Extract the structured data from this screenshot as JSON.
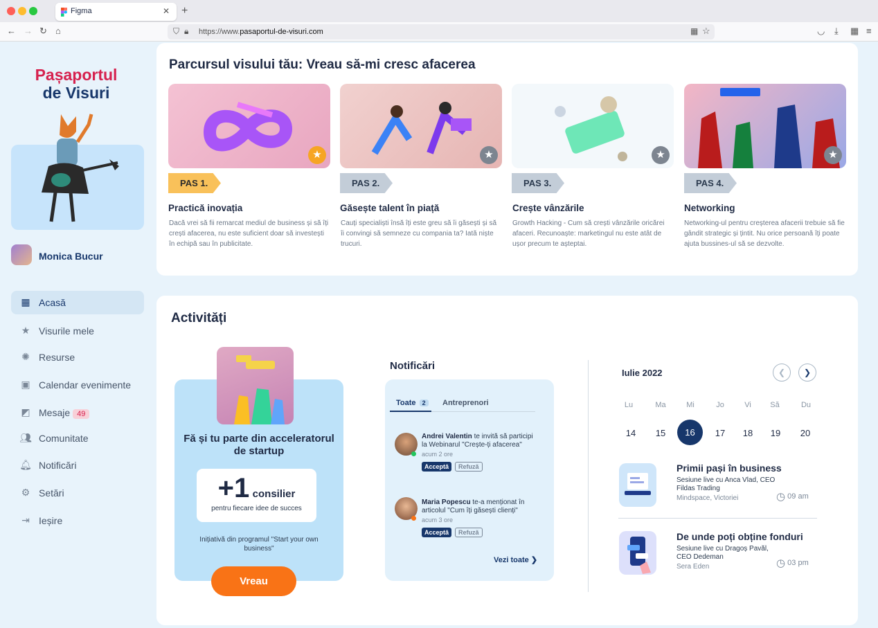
{
  "browser": {
    "tab_title": "Figma",
    "url_prefix": "https://www.",
    "url_domain": "pasaportul-de-visuri.com"
  },
  "sidebar": {
    "logo_line1": "Pașaportul",
    "logo_line2": "de Visuri",
    "user_name": "Monica Bucur",
    "items": [
      {
        "label": "Acasă",
        "icon": "grid-icon",
        "active": true
      },
      {
        "label": "Visurile mele",
        "icon": "star-icon"
      },
      {
        "label": "Resurse",
        "icon": "bulb-icon"
      },
      {
        "label": "Calendar evenimente",
        "icon": "calendar-icon"
      },
      {
        "label": "Mesaje",
        "icon": "chat-icon",
        "badge": "49"
      },
      {
        "label": "Comunitate",
        "icon": "people-icon"
      },
      {
        "label": "Notificări",
        "icon": "bell-icon"
      },
      {
        "label": "Setări",
        "icon": "gear-icon"
      },
      {
        "label": "Ieșire",
        "icon": "logout-icon"
      }
    ]
  },
  "journey": {
    "title": "Parcursul visului tău:  Vreau să-mi cresc afacerea",
    "steps": [
      {
        "pas": "PAS 1.",
        "title": "Practică inovația",
        "desc": "Dacă vrei să fii remarcat mediul de business și să îți crești afacerea, nu este suficient doar să investești în echipă sau în publicitate.",
        "star": "gold"
      },
      {
        "pas": "PAS 2.",
        "title": "Găsește talent în piață",
        "desc": "Cauți specialiști însă îți este greu să îi găsești și să îi convingi să semneze cu compania ta? Iată niște trucuri.",
        "star": "grey"
      },
      {
        "pas": "PAS 3.",
        "title": "Crește vânzările",
        "desc": "Growth Hacking - Cum să crești vânzările oricărei afaceri. Recunoaște: marketingul nu este atât de ușor precum te așteptai.",
        "star": "grey"
      },
      {
        "pas": "PAS 4.",
        "title": "Networking",
        "desc": "Networking-ul pentru creșterea afacerii trebuie să fie gândit strategic și țintit. Nu orice persoană îți poate ajuta bussines-ul să se dezvolte.",
        "star": "grey"
      }
    ]
  },
  "activities": {
    "title": "Activități",
    "accelerator": {
      "title": "Fă și tu parte din acceleratorul de startup",
      "big": "+1",
      "big_word": "consilier",
      "sub": "pentru fiecare idee de succes",
      "note": "Inițiativă din programul \"Start your own business\"",
      "button": "Vreau"
    },
    "notifications": {
      "title": "Notificări",
      "tab_all": "Toate",
      "tab_all_count": "2",
      "tab_other": "Antreprenori",
      "items": [
        {
          "name": "Andrei Valentin",
          "text": " te invită să participi la Webinarul \"Crește-ți afacerea\"",
          "time": "acum 2 ore",
          "accept": "Acceptă",
          "refuse": "Refuză"
        },
        {
          "name": "Maria Popescu",
          "text": " te-a menționat în articolul \"Cum îți găsești clienți\"",
          "time": "acum 3 ore",
          "accept": "Acceptă",
          "refuse": "Refuză"
        }
      ],
      "see_all": "Vezi toate"
    },
    "calendar": {
      "month": "Iulie 2022",
      "weekdays": [
        "Lu",
        "Ma",
        "Mi",
        "Jo",
        "Vi",
        "Să",
        "Du"
      ],
      "days": [
        "14",
        "15",
        "16",
        "17",
        "18",
        "19",
        "20"
      ],
      "selected": "16",
      "events": [
        {
          "title": "Primii pași în business",
          "sub": "Sesiune live cu Anca Vlad, CEO Fildas Trading",
          "loc": "Mindspace, Victoriei",
          "time": "09 am"
        },
        {
          "title": "De unde poți obține fonduri",
          "sub": "Sesiune live cu Dragoș Pavăl, CEO Dedeman",
          "loc": "Sera Eden",
          "time": "03 pm"
        }
      ]
    }
  }
}
